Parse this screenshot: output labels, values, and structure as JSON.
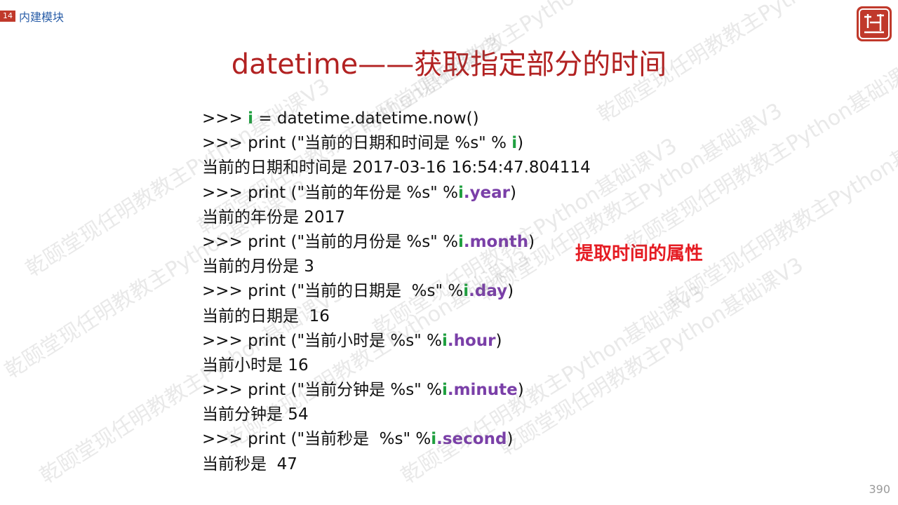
{
  "header": {
    "chapter_number": "14",
    "chapter_title": "内建模块"
  },
  "logo": {
    "text": "颐乾堂"
  },
  "title": "datetime——获取指定部分的时间",
  "code_lines": [
    {
      "parts": [
        {
          "t": ">>> ",
          "c": ""
        },
        {
          "t": "i",
          "c": "grn"
        },
        {
          "t": " = datetime.datetime.now()",
          "c": ""
        }
      ]
    },
    {
      "parts": [
        {
          "t": ">>> print (\"当前的日期和时间是 %s\" % ",
          "c": ""
        },
        {
          "t": "i",
          "c": "grn"
        },
        {
          "t": ")",
          "c": ""
        }
      ]
    },
    {
      "parts": [
        {
          "t": "当前的日期和时间是 2017-03-16 16:54:47.804114",
          "c": ""
        }
      ]
    },
    {
      "parts": [
        {
          "t": ">>> print (\"当前的年份是 %s\" %",
          "c": ""
        },
        {
          "t": "i",
          "c": "grn"
        },
        {
          "t": ".year",
          "c": "pur"
        },
        {
          "t": ")",
          "c": ""
        }
      ]
    },
    {
      "parts": [
        {
          "t": "当前的年份是 2017",
          "c": ""
        }
      ]
    },
    {
      "parts": [
        {
          "t": ">>> print (\"当前的月份是 %s\" %",
          "c": ""
        },
        {
          "t": "i",
          "c": "grn"
        },
        {
          "t": ".month",
          "c": "pur"
        },
        {
          "t": ")",
          "c": ""
        }
      ]
    },
    {
      "parts": [
        {
          "t": "当前的月份是 3",
          "c": ""
        }
      ]
    },
    {
      "parts": [
        {
          "t": ">>> print (\"当前的日期是  %s\" %",
          "c": ""
        },
        {
          "t": "i",
          "c": "grn"
        },
        {
          "t": ".day",
          "c": "pur"
        },
        {
          "t": ")",
          "c": ""
        }
      ]
    },
    {
      "parts": [
        {
          "t": "当前的日期是  16",
          "c": ""
        }
      ]
    },
    {
      "parts": [
        {
          "t": ">>> print (\"当前小时是 %s\" %",
          "c": ""
        },
        {
          "t": "i",
          "c": "grn"
        },
        {
          "t": ".hour",
          "c": "pur"
        },
        {
          "t": ")",
          "c": ""
        }
      ]
    },
    {
      "parts": [
        {
          "t": "当前小时是 16",
          "c": ""
        }
      ]
    },
    {
      "parts": [
        {
          "t": ">>> print (\"当前分钟是 %s\" %",
          "c": ""
        },
        {
          "t": "i",
          "c": "grn"
        },
        {
          "t": ".minute",
          "c": "pur"
        },
        {
          "t": ")",
          "c": ""
        }
      ]
    },
    {
      "parts": [
        {
          "t": "当前分钟是 54",
          "c": ""
        }
      ]
    },
    {
      "parts": [
        {
          "t": ">>> print (\"当前秒是  %s\" %",
          "c": ""
        },
        {
          "t": "i",
          "c": "grn"
        },
        {
          "t": ".second",
          "c": "pur"
        },
        {
          "t": ")",
          "c": ""
        }
      ]
    },
    {
      "parts": [
        {
          "t": "当前秒是  47",
          "c": ""
        }
      ]
    }
  ],
  "annotation": "提取时间的属性",
  "watermark": "乾颐堂现任明教教主Python基础课V3",
  "page_number": "390",
  "colors": {
    "title": "#b22222",
    "variable": "#1f9f3f",
    "attribute": "#7a3fa8",
    "annotation": "#e51c23"
  }
}
